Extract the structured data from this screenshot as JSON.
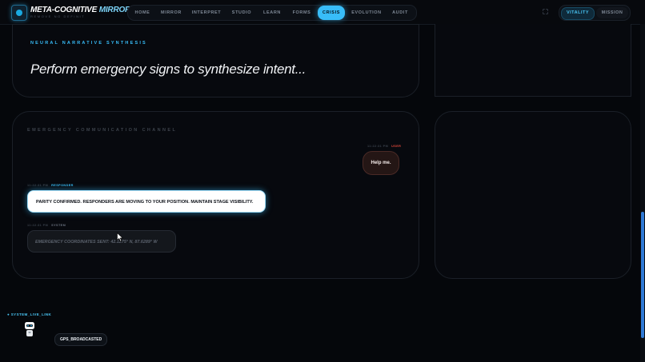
{
  "app": {
    "title_part1": "META-COGNITIVE",
    "title_part2": "MIRROR",
    "subtitle": "REMOVE NO DEFINIT",
    "logo_icon": "mirror-logo-icon"
  },
  "nav": {
    "items": [
      {
        "label": "HOME"
      },
      {
        "label": "MIRROR"
      },
      {
        "label": "INTERPRET"
      },
      {
        "label": "STUDIO"
      },
      {
        "label": "LEARN"
      },
      {
        "label": "FORMS"
      },
      {
        "label": "CRISIS"
      },
      {
        "label": "EVOLUTION"
      },
      {
        "label": "AUDIT"
      }
    ],
    "active": "CRISIS"
  },
  "header_right": {
    "expand_icon": "expand-icon",
    "tabs": [
      {
        "label": "VITALITY"
      },
      {
        "label": "MISSION"
      }
    ]
  },
  "synthesis": {
    "label": "NEURAL NARRATIVE SYNTHESIS",
    "text": "Perform emergency signs to synthesize intent..."
  },
  "channel": {
    "label": "EMERGENCY COMMUNICATION CHANNEL",
    "messages": [
      {
        "time": "11:22:31 PM",
        "sender": "USER",
        "text": "Help me."
      },
      {
        "time": "11:22:31 PM",
        "sender": "RESPONDER",
        "text": "PARITY CONFIRMED. RESPONDERS ARE MOVING TO YOUR POSITION. MAINTAIN STAGE VISIBILITY."
      },
      {
        "time": "11:22:31 PM",
        "sender": "SYSTEM",
        "text": "EMERGENCY COORDINATES SENT: 42.1275° N, 87.6289° W"
      }
    ]
  },
  "status": {
    "live_link": "● SYSTEM_LIVE_LINK",
    "gps": "GPS_BROADCASTED",
    "robot_icon": "robot-avatar-icon"
  },
  "colors": {
    "accent": "#38bdf8",
    "user": "#e0483a",
    "background": "#05070b"
  }
}
